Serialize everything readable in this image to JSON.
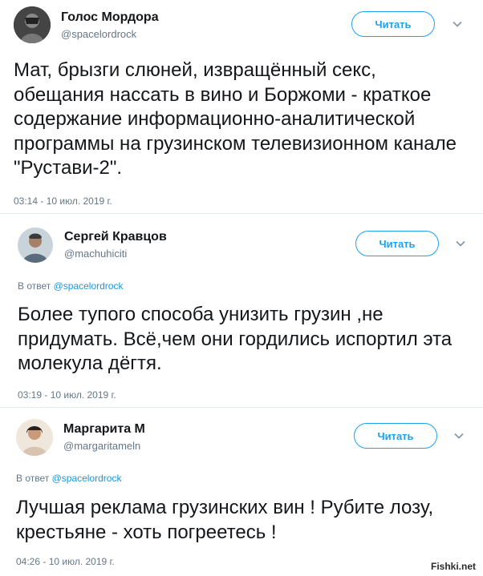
{
  "tweets": [
    {
      "name": "Голос Мордора",
      "handle": "@spacelordrock",
      "follow_label": "Читать",
      "reply_prefix": "",
      "reply_handle": "",
      "text": "Мат, брызги слюней, извращённый секс, обещания нассать в вино и Боржоми - краткое содержание информационно-аналитической программы на грузинском телевизионном канале \"Рустави-2\".",
      "time": "03:14 - 10 июл. 2019 г."
    },
    {
      "name": "Сергей Кравцов",
      "handle": "@machuhiciti",
      "follow_label": "Читать",
      "reply_prefix": "В ответ ",
      "reply_handle": "@spacelordrock",
      "text": "Более тупого способа унизить грузин ,не придумать. Всё,чем они гордились испортил эта молекула дёгтя.",
      "time": "03:19 - 10 июл. 2019 г."
    },
    {
      "name": "Маргарита М",
      "handle": "@margaritameln",
      "follow_label": "Читать",
      "reply_prefix": "В ответ ",
      "reply_handle": "@spacelordrock",
      "text": "Лучшая реклама грузинских вин ! Рубите лозу, крестьяне - хоть погреетесь !",
      "time": "04:26 - 10 июл. 2019 г."
    }
  ],
  "watermark": "Fishki.net",
  "colors": {
    "accent": "#1da1f2",
    "link": "#1b95e0",
    "muted": "#657786",
    "text": "#14171a"
  }
}
